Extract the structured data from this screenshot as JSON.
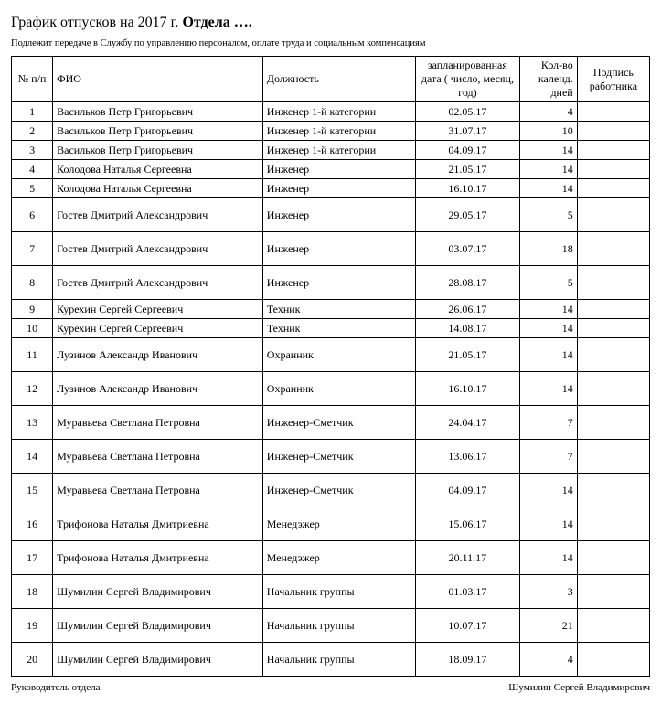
{
  "title_prefix": "График отпусков на 2017 г. ",
  "title_bold": "Отдела ….",
  "subtext": "Подлежит передаче в Службу по управлению персоналом, оплате труда и социальным компенсациям",
  "headers": {
    "num": "№ п/п",
    "fio": "ФИО",
    "pos": "Должность",
    "date": "запланированная дата ( число, месяц, год)",
    "days": "Кол-во календ. дней",
    "sign": "Подпись работника"
  },
  "rows": [
    {
      "n": "1",
      "fio": "Васильков Петр Григорьевич",
      "pos": "Инженер 1-й категории",
      "date": "02.05.17",
      "days": "4",
      "tall": false
    },
    {
      "n": "2",
      "fio": "Васильков Петр Григорьевич",
      "pos": "Инженер 1-й категории",
      "date": "31.07.17",
      "days": "10",
      "tall": false
    },
    {
      "n": "3",
      "fio": "Васильков Петр Григорьевич",
      "pos": "Инженер 1-й категории",
      "date": "04.09.17",
      "days": "14",
      "tall": false
    },
    {
      "n": "4",
      "fio": "Колодова Наталья Сергеевна",
      "pos": "Инженер",
      "date": "21.05.17",
      "days": "14",
      "tall": false
    },
    {
      "n": "5",
      "fio": "Колодова Наталья Сергеевна",
      "pos": "Инженер",
      "date": "16.10.17",
      "days": "14",
      "tall": false
    },
    {
      "n": "6",
      "fio": "Гостев Дмитрий Александрович",
      "pos": "Инженер",
      "date": "29.05.17",
      "days": "5",
      "tall": true
    },
    {
      "n": "7",
      "fio": "Гостев Дмитрий Александрович",
      "pos": "Инженер",
      "date": "03.07.17",
      "days": "18",
      "tall": true
    },
    {
      "n": "8",
      "fio": "Гостев Дмитрий Александрович",
      "pos": "Инженер",
      "date": "28.08.17",
      "days": "5",
      "tall": true
    },
    {
      "n": "9",
      "fio": "Курехин Сергей Сергеевич",
      "pos": "Техник",
      "date": "26.06.17",
      "days": "14",
      "tall": false
    },
    {
      "n": "10",
      "fio": "Курехин Сергей Сергеевич",
      "pos": "Техник",
      "date": "14.08.17",
      "days": "14",
      "tall": false
    },
    {
      "n": "11",
      "fio": "Лузинов Александр Иванович",
      "pos": "Охранник",
      "date": "21.05.17",
      "days": "14",
      "tall": true
    },
    {
      "n": "12",
      "fio": "Лузинов Александр Иванович",
      "pos": "Охранник",
      "date": "16.10.17",
      "days": "14",
      "tall": true
    },
    {
      "n": "13",
      "fio": "Муравьева Светлана Петровна",
      "pos": "Инженер-Сметчик",
      "date": "24.04.17",
      "days": "7",
      "tall": true
    },
    {
      "n": "14",
      "fio": "Муравьева Светлана Петровна",
      "pos": "Инженер-Сметчик",
      "date": "13.06.17",
      "days": "7",
      "tall": true
    },
    {
      "n": "15",
      "fio": "Муравьева Светлана Петровна",
      "pos": "Инженер-Сметчик",
      "date": "04.09.17",
      "days": "14",
      "tall": true
    },
    {
      "n": "16",
      "fio": "Трифонова Наталья Дмитриевна",
      "pos": "Менедэжер",
      "date": "15.06.17",
      "days": "14",
      "tall": true
    },
    {
      "n": "17",
      "fio": "Трифонова Наталья Дмитриевна",
      "pos": "Менедэжер",
      "date": "20.11.17",
      "days": "14",
      "tall": true
    },
    {
      "n": "18",
      "fio": "Шумилин Сергей Владимирович",
      "pos": "Начальник группы",
      "date": "01.03.17",
      "days": "3",
      "tall": true
    },
    {
      "n": "19",
      "fio": "Шумилин Сергей Владимирович",
      "pos": "Начальник группы",
      "date": "10.07.17",
      "days": "21",
      "tall": true
    },
    {
      "n": "20",
      "fio": "Шумилин Сергей Владимирович",
      "pos": "Начальник группы",
      "date": "18.09.17",
      "days": "4",
      "tall": true
    }
  ],
  "footer_left": "Руководитель отдела",
  "footer_right": "Шумилин Сергей Владимирович"
}
